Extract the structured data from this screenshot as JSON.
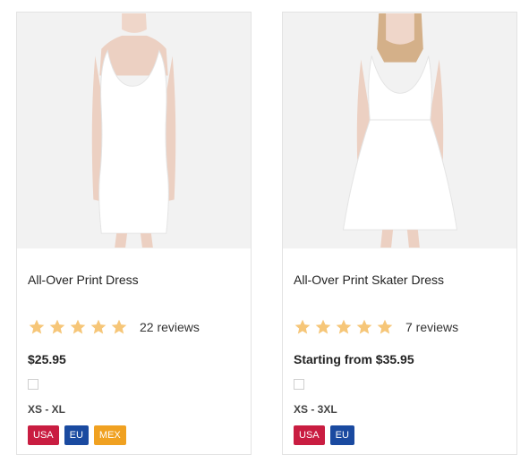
{
  "products": [
    {
      "title": "All-Over Print Dress",
      "rating": 5,
      "reviews": "22 reviews",
      "price": "$25.95",
      "sizes": "XS - XL",
      "regions": [
        "USA",
        "EU",
        "MEX"
      ]
    },
    {
      "title": "All-Over Print Skater Dress",
      "rating": 5,
      "reviews": "7 reviews",
      "price": "Starting from $35.95",
      "sizes": "XS - 3XL",
      "regions": [
        "USA",
        "EU"
      ]
    }
  ],
  "colors": {
    "star": "#f6c678",
    "usa": "#c91d41",
    "eu": "#1a4aa0",
    "mex": "#f0a121"
  }
}
